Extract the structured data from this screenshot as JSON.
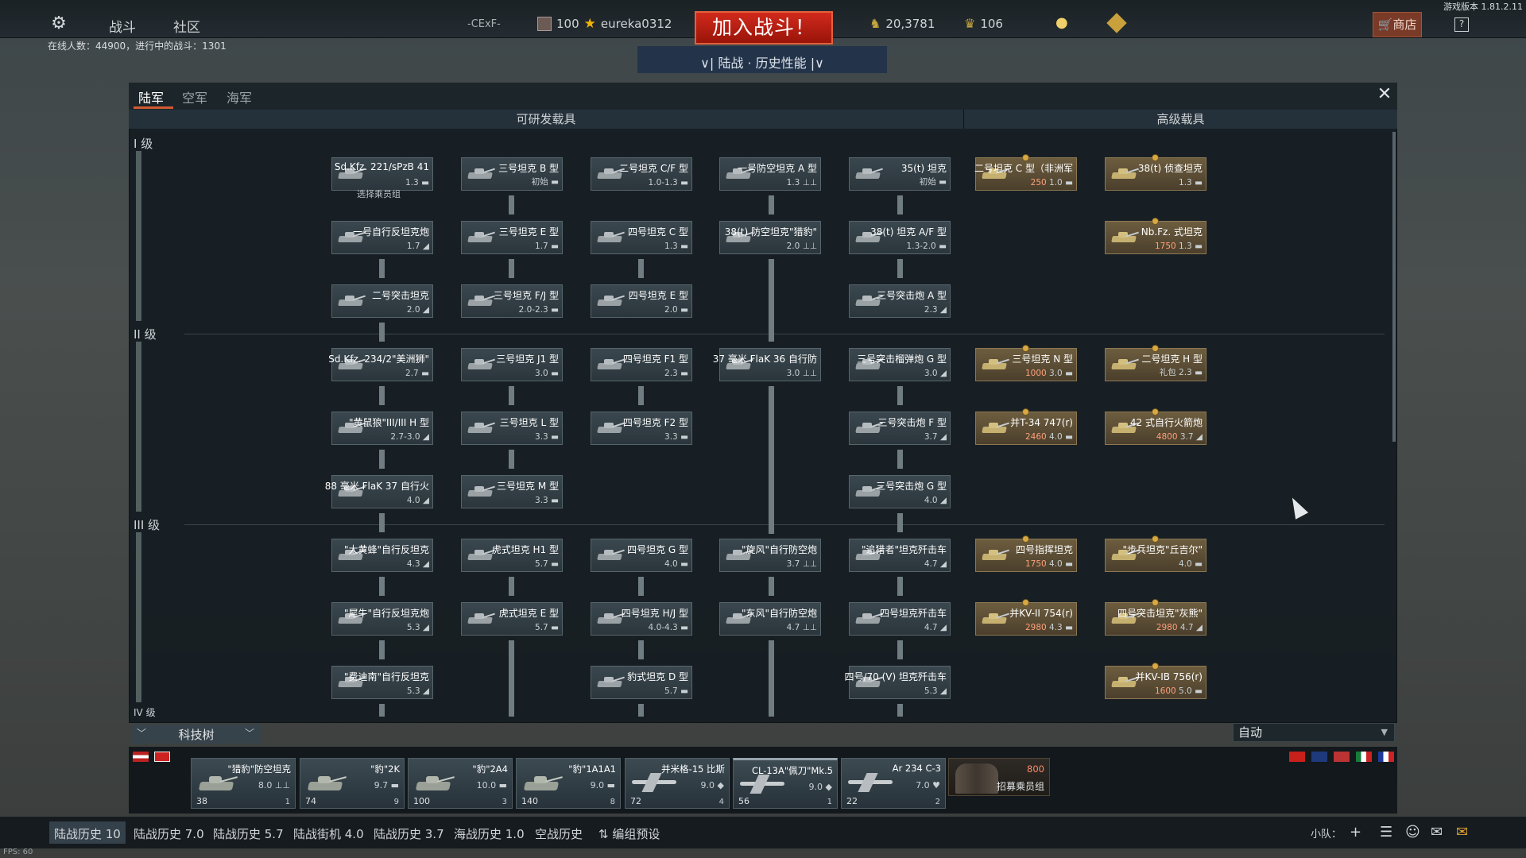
{
  "topbar": {
    "version": "游戏版本 1.81.2.11",
    "nav_battle": "战斗",
    "nav_community": "社区",
    "squad_tag": "-CExF-",
    "player_level": "100",
    "player_name": "eureka0312",
    "join_button": "加入战斗！",
    "mode_label": "∨| 陆战 · 历史性能 |∨",
    "silver": "20,3781",
    "gold": "106",
    "shop": "商店",
    "help": "?",
    "online": "在线人数：44900，进行中的战斗：1301"
  },
  "window": {
    "tabs": [
      "陆军",
      "空军",
      "海军"
    ],
    "header_research": "可研发载具",
    "header_premium": "高级载具",
    "close": "✕",
    "ranks": [
      "I 级",
      "II 级",
      "III 级",
      "IV 级"
    ],
    "crew_select": "选择乘员组"
  },
  "vehicles": [
    {
      "name": "Sd.Kfz. 221/sPzB 41",
      "br": "1.3 ▬",
      "prem": false
    },
    {
      "name": "三号坦克 B 型",
      "br": "初始 ▬",
      "prem": false
    },
    {
      "name": "二号坦克 C/F 型",
      "br": "1.0-1.3 ▬",
      "prem": false
    },
    {
      "name": "一号防空坦克 A 型",
      "br": "1.3 ⊥⊥",
      "prem": false
    },
    {
      "name": "35(t) 坦克",
      "br": "初始 ▬",
      "prem": false
    },
    {
      "name": "二号坦克 C 型（非洲军",
      "br": "1.0 ▬",
      "cost": "250",
      "prem": true
    },
    {
      "name": "38(t) 侦查坦克",
      "br": "1.3 ▬",
      "prem": true
    },
    {
      "name": "一号自行反坦克炮",
      "br": "1.7 ◢",
      "prem": false
    },
    {
      "name": "三号坦克 E 型",
      "br": "1.7 ▬",
      "prem": false
    },
    {
      "name": "四号坦克 C 型",
      "br": "1.3 ▬",
      "prem": false
    },
    {
      "name": "38(t) 防空坦克\"猎豹\"",
      "br": "2.0 ⊥⊥",
      "prem": false
    },
    {
      "name": "38(t) 坦克 A/F 型",
      "br": "1.3-2.0 ▬",
      "prem": false
    },
    {
      "name": "Nb.Fz. 式坦克",
      "br": "1.3 ▬",
      "cost": "1750",
      "prem": true
    },
    {
      "name": "二号突击坦克",
      "br": "2.0 ◢",
      "prem": false
    },
    {
      "name": "三号坦克 F/J 型",
      "br": "2.0-2.3 ▬",
      "prem": false
    },
    {
      "name": "四号坦克 E 型",
      "br": "2.0 ▬",
      "prem": false
    },
    {
      "name": "三号突击炮 A 型",
      "br": "2.3 ◢",
      "prem": false
    },
    {
      "name": "Sd.Kfz. 234/2\"美洲狮\"",
      "br": "2.7 ▬",
      "prem": false
    },
    {
      "name": "三号坦克 J1 型",
      "br": "3.0 ▬",
      "prem": false
    },
    {
      "name": "四号坦克 F1 型",
      "br": "2.3 ▬",
      "prem": false
    },
    {
      "name": "37 毫米 FlaK 36 自行防",
      "br": "3.0 ⊥⊥",
      "prem": false
    },
    {
      "name": "三号突击榴弹炮 G 型",
      "br": "3.0 ◢",
      "prem": false
    },
    {
      "name": "三号坦克 N 型",
      "br": "3.0 ▬",
      "cost": "1000",
      "prem": true
    },
    {
      "name": "二号坦克 H 型",
      "br": "礼包 2.3 ▬",
      "prem": true
    },
    {
      "name": "\"黄鼠狼\"III/III H 型",
      "br": "2.7-3.0 ◢",
      "prem": false
    },
    {
      "name": "三号坦克 L 型",
      "br": "3.3 ▬",
      "prem": false
    },
    {
      "name": "四号坦克 F2 型",
      "br": "3.3 ▬",
      "prem": false
    },
    {
      "name": "三号突击炮 F 型",
      "br": "3.7 ◢",
      "prem": false
    },
    {
      "name": "并T-34 747(r)",
      "br": "4.0 ▬",
      "cost": "2460",
      "prem": true
    },
    {
      "name": "42 式自行火箭炮",
      "br": "3.7 ◢",
      "cost": "4800",
      "prem": true
    },
    {
      "name": "88 毫米 FlaK 37 自行火",
      "br": "4.0 ◢",
      "prem": false
    },
    {
      "name": "三号坦克 M 型",
      "br": "3.3 ▬",
      "prem": false
    },
    {
      "name": "三号突击炮 G 型",
      "br": "4.0 ◢",
      "prem": false
    },
    {
      "name": "\"大黄蜂\"自行反坦克",
      "br": "4.3 ◢",
      "prem": false
    },
    {
      "name": "虎式坦克 H1 型",
      "br": "5.7 ▬",
      "prem": false
    },
    {
      "name": "四号坦克 G 型",
      "br": "4.0 ▬",
      "prem": false
    },
    {
      "name": "\"旋风\"自行防空炮",
      "br": "3.7 ⊥⊥",
      "prem": false
    },
    {
      "name": "\"追猎者\"坦克歼击车",
      "br": "4.7 ◢",
      "prem": false
    },
    {
      "name": "四号指挥坦克",
      "br": "4.0 ▬",
      "cost": "1750",
      "prem": true
    },
    {
      "name": "\"步兵坦克\"丘吉尔\"",
      "br": "4.0 ▬",
      "prem": true
    },
    {
      "name": "\"犀牛\"自行反坦克炮",
      "br": "5.3 ◢",
      "prem": false
    },
    {
      "name": "虎式坦克 E 型",
      "br": "5.7 ▬",
      "prem": false
    },
    {
      "name": "四号坦克 H/J 型",
      "br": "4.0-4.3 ▬",
      "prem": false
    },
    {
      "name": "\"东风\"自行防空炮",
      "br": "4.7 ⊥⊥",
      "prem": false
    },
    {
      "name": "四号坦克歼击车",
      "br": "4.7 ◢",
      "prem": false
    },
    {
      "name": "并KV-II 754(r)",
      "br": "4.3 ▬",
      "cost": "2980",
      "prem": true
    },
    {
      "name": "四号突击坦克\"灰熊\"",
      "br": "4.7 ◢",
      "cost": "2980",
      "prem": true
    },
    {
      "name": "\"费迪南\"自行反坦克",
      "br": "5.3 ◢",
      "prem": false
    },
    {
      "name": "豹式坦克 D 型",
      "br": "5.7 ▬",
      "prem": false
    },
    {
      "name": "四号/70 (V) 坦克歼击车",
      "br": "5.3 ◢",
      "prem": false
    },
    {
      "name": "并KV-IB 756(r)",
      "br": "5.0 ▬",
      "cost": "1600",
      "prem": true
    }
  ],
  "bottom": {
    "techtree": "科技树",
    "auto": "自动",
    "slots": [
      {
        "name": "\"猎豹\"防空坦克",
        "br": "8.0 ⊥⊥",
        "crew": "38",
        "lvl": "1",
        "kind": "tank"
      },
      {
        "name": "\"豹\"2K",
        "br": "9.7 ▬",
        "crew": "74",
        "lvl": "9",
        "kind": "tank"
      },
      {
        "name": "\"豹\"2A4",
        "br": "10.0 ▬",
        "crew": "100",
        "lvl": "3",
        "kind": "tank"
      },
      {
        "name": "\"豹\"1A1A1",
        "br": "9.0 ▬",
        "crew": "140",
        "lvl": "8",
        "kind": "tank"
      },
      {
        "name": "并米格-15 比斯",
        "br": "9.0 ◆",
        "crew": "72",
        "lvl": "4",
        "kind": "plane"
      },
      {
        "name": "CL-13A\"佩刀\"Mk.5",
        "br": "9.0 ◆",
        "crew": "56",
        "lvl": "1",
        "kind": "plane"
      },
      {
        "name": "Ar 234 C-3",
        "br": "7.0 ♥",
        "crew": "22",
        "lvl": "2",
        "kind": "plane"
      }
    ],
    "recruit_cost": "800",
    "recruit_label": "招募乘员组",
    "presets": [
      "陆战历史 10",
      "陆战历史 7.0",
      "陆战历史 5.7",
      "陆战街机 4.0",
      "陆战历史 3.7",
      "海战历史 1.0",
      "空战历史",
      "⇅ 编组预设"
    ],
    "squad": "小队：",
    "fps": "FPS: 60"
  }
}
